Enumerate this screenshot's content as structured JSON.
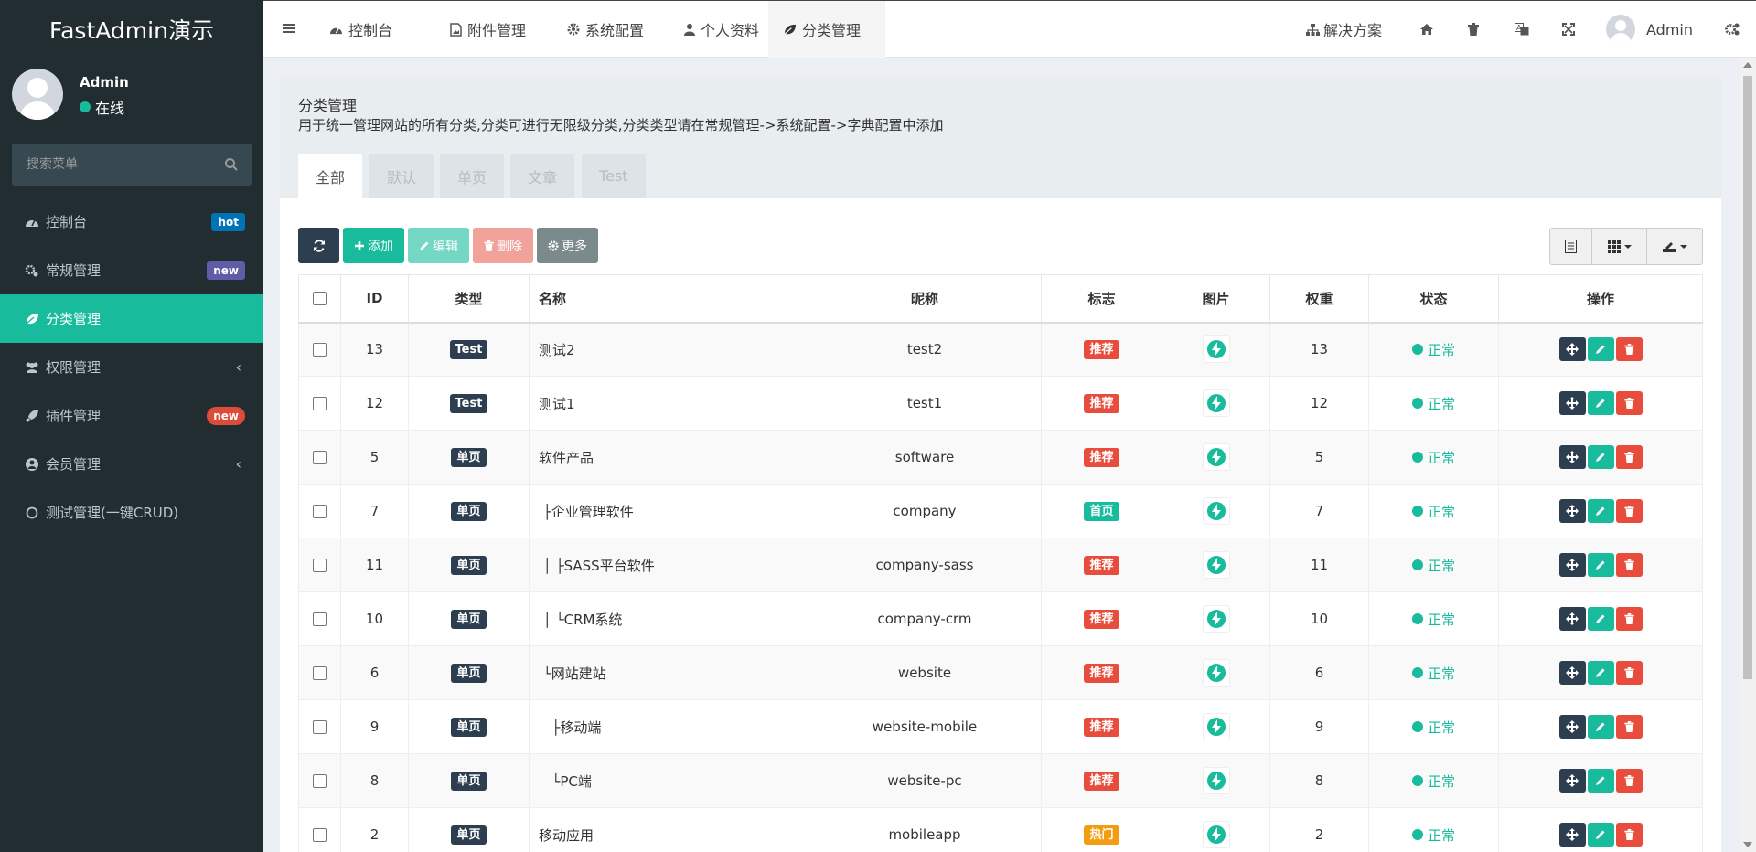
{
  "app": {
    "logo": "FastAdmin演示"
  },
  "user": {
    "name": "Admin",
    "status": "在线"
  },
  "sidebar": {
    "search_placeholder": "搜索菜单",
    "items": [
      {
        "label": "控制台",
        "icon": "dashboard-icon",
        "badge": "hot",
        "badge_color": "#0073b7"
      },
      {
        "label": "常规管理",
        "icon": "cogs-icon",
        "badge": "new",
        "badge_color": "#605ca8"
      },
      {
        "label": "分类管理",
        "icon": "leaf-icon",
        "active": true
      },
      {
        "label": "权限管理",
        "icon": "users-icon",
        "submenu": true
      },
      {
        "label": "插件管理",
        "icon": "rocket-icon",
        "badge": "new",
        "badge_color": "#dd4b39"
      },
      {
        "label": "会员管理",
        "icon": "user-circle-icon",
        "submenu": true
      },
      {
        "label": "测试管理(一键CRUD)",
        "icon": "circle-icon"
      }
    ]
  },
  "topnav": {
    "tabs": [
      {
        "label": "控制台",
        "icon": "dashboard-icon"
      },
      {
        "label": "附件管理",
        "icon": "file-image-icon"
      },
      {
        "label": "系统配置",
        "icon": "cog-icon"
      },
      {
        "label": "个人资料",
        "icon": "user-icon"
      },
      {
        "label": "分类管理",
        "icon": "leaf-icon",
        "active": true
      }
    ],
    "solutions": "解决方案",
    "admin": "Admin"
  },
  "page": {
    "title": "分类管理",
    "description": "用于统一管理网站的所有分类,分类可进行无限级分类,分类类型请在常规管理->系统配置->字典配置中添加",
    "tabs": [
      "全部",
      "默认",
      "单页",
      "文章",
      "Test"
    ]
  },
  "toolbar": {
    "add": "添加",
    "edit": "编辑",
    "delete": "删除",
    "more": "更多"
  },
  "table": {
    "headers": [
      "ID",
      "类型",
      "名称",
      "昵称",
      "标志",
      "图片",
      "权重",
      "状态",
      "操作"
    ],
    "rows": [
      {
        "id": "13",
        "type": "Test",
        "name": "测试2",
        "nickname": "test2",
        "flag": "推荐",
        "weight": "13",
        "status": "正常"
      },
      {
        "id": "12",
        "type": "Test",
        "name": "测试1",
        "nickname": "test1",
        "flag": "推荐",
        "weight": "12",
        "status": "正常"
      },
      {
        "id": "5",
        "type": "单页",
        "name": "软件产品",
        "nickname": "software",
        "flag": "推荐",
        "weight": "5",
        "status": "正常"
      },
      {
        "id": "7",
        "type": "单页",
        "name": " ├企业管理软件",
        "nickname": "company",
        "flag": "首页",
        "weight": "7",
        "status": "正常"
      },
      {
        "id": "11",
        "type": "单页",
        "name": " │ ├SASS平台软件",
        "nickname": "company-sass",
        "flag": "推荐",
        "weight": "11",
        "status": "正常"
      },
      {
        "id": "10",
        "type": "单页",
        "name": " │ └CRM系统",
        "nickname": "company-crm",
        "flag": "推荐",
        "weight": "10",
        "status": "正常"
      },
      {
        "id": "6",
        "type": "单页",
        "name": " └网站建站",
        "nickname": "website",
        "flag": "推荐",
        "weight": "6",
        "status": "正常"
      },
      {
        "id": "9",
        "type": "单页",
        "name": "   ├移动端",
        "nickname": "website-mobile",
        "flag": "推荐",
        "weight": "9",
        "status": "正常"
      },
      {
        "id": "8",
        "type": "单页",
        "name": "   └PC端",
        "nickname": "website-pc",
        "flag": "推荐",
        "weight": "8",
        "status": "正常"
      },
      {
        "id": "2",
        "type": "单页",
        "name": "移动应用",
        "nickname": "mobileapp",
        "flag": "热门",
        "weight": "2",
        "status": "正常"
      }
    ]
  },
  "colors": {
    "sidebar_bg": "#222d32",
    "accent": "#18bc9c",
    "dark": "#2c3e50",
    "danger": "#e74c3c",
    "warning": "#f39c12",
    "grey_btn": "#95a5a6",
    "flag_推荐": "#e74c3c",
    "flag_首页": "#18bc9c",
    "flag_热门": "#f39c12"
  }
}
